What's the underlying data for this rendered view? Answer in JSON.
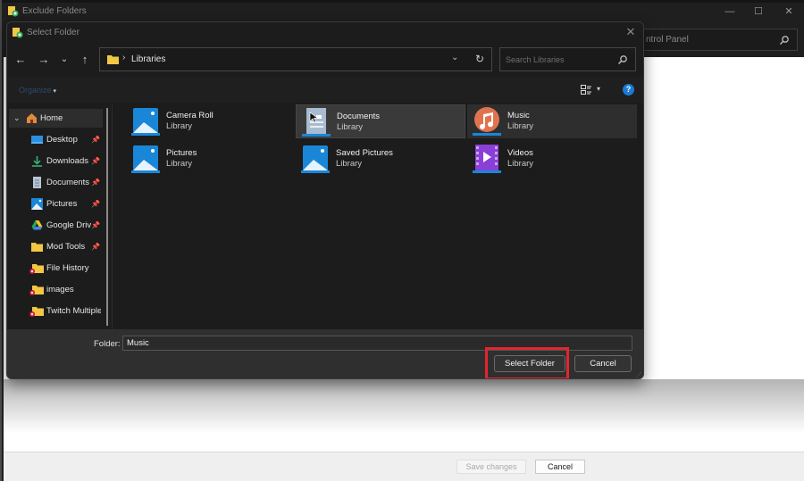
{
  "parent_window": {
    "title": "Exclude Folders",
    "controls": {
      "minimize": "—",
      "maximize": "☐",
      "close": "✕"
    },
    "search_text": "ntrol Panel",
    "footer": {
      "save_label": "Save changes",
      "cancel_label": "Cancel"
    }
  },
  "dialog": {
    "title": "Select Folder",
    "close": "✕",
    "nav": {
      "back": "←",
      "forward": "→",
      "recent": "⌄",
      "up": "↑"
    },
    "address": {
      "separator": "›",
      "crumb": "Libraries",
      "dropdown": "⌄",
      "refresh": "↻"
    },
    "search": {
      "placeholder": "Search Libraries"
    },
    "toolbar": {
      "organize": "Organize",
      "organize_caret": "▾",
      "view_caret": "▾",
      "help": "?"
    },
    "sidebar": {
      "items": [
        {
          "label": "Home",
          "icon": "home-icon",
          "expanded": true
        },
        {
          "label": "Desktop",
          "icon": "desktop-icon",
          "pinned": true
        },
        {
          "label": "Downloads",
          "icon": "download-icon",
          "pinned": true
        },
        {
          "label": "Documents",
          "icon": "document-icon",
          "pinned": true
        },
        {
          "label": "Pictures",
          "icon": "pictures-icon",
          "pinned": true
        },
        {
          "label": "Google Drive",
          "icon": "google-drive-icon",
          "pinned": true
        },
        {
          "label": "Mod Tools",
          "icon": "folder-icon",
          "pinned": true
        },
        {
          "label": "File History",
          "icon": "folder-error-icon",
          "pinned": false
        },
        {
          "label": "images",
          "icon": "folder-error-icon",
          "pinned": false
        },
        {
          "label": "Twitch Multiple",
          "icon": "folder-error-icon",
          "pinned": false
        }
      ],
      "pin_glyph": "📌",
      "chevron": "⌄"
    },
    "libraries": [
      {
        "name": "Camera Roll",
        "type": "Library",
        "icon": "pictures-library-icon",
        "state": "normal"
      },
      {
        "name": "Documents",
        "type": "Library",
        "icon": "documents-library-icon",
        "state": "selected"
      },
      {
        "name": "Music",
        "type": "Library",
        "icon": "music-library-icon",
        "state": "hover"
      },
      {
        "name": "Pictures",
        "type": "Library",
        "icon": "pictures-library-icon",
        "state": "normal"
      },
      {
        "name": "Saved Pictures",
        "type": "Library",
        "icon": "pictures-library-icon",
        "state": "normal"
      },
      {
        "name": "Videos",
        "type": "Library",
        "icon": "videos-library-icon",
        "state": "normal"
      }
    ],
    "footer": {
      "folder_label": "Folder:",
      "folder_value": "Music",
      "select_label": "Select Folder",
      "cancel_label": "Cancel"
    }
  },
  "colors": {
    "highlight_box": "#e0262e",
    "help_blue": "#1a7ad4",
    "library_blue": "#1a86d8",
    "music_orange": "#e0734f",
    "videos_purple": "#8a3fd6",
    "folder_yellow": "#f2c744"
  }
}
